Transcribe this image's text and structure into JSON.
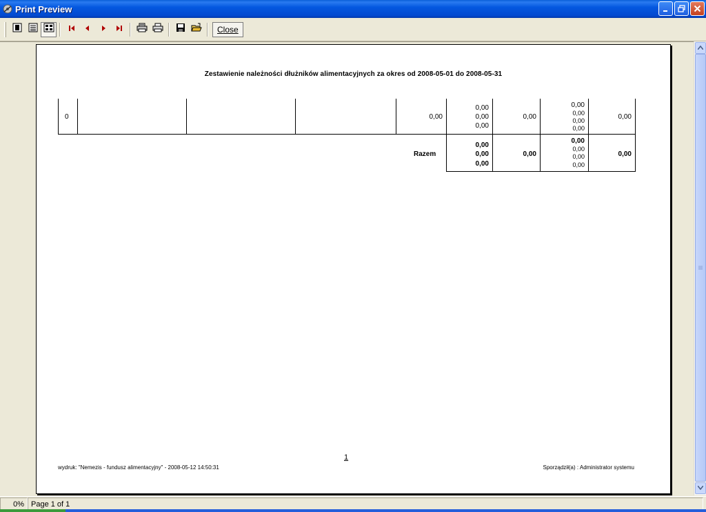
{
  "window": {
    "title": "Print Preview",
    "buttons": [
      "minimize",
      "restore",
      "close"
    ]
  },
  "toolbar": {
    "close_label": "Close",
    "icons": [
      "one-page-icon",
      "continuous-icon",
      "multi-page-icon",
      "first-page-icon",
      "prev-page-icon",
      "next-page-icon",
      "last-page-icon",
      "printer-setup-icon",
      "print-icon",
      "save-icon",
      "open-icon"
    ]
  },
  "report": {
    "title": "Zestawienie należności dłużników alimentacyjnych za okres od 2008-05-01 do 2008-05-31",
    "row": {
      "lp": "0",
      "col5": "0,00",
      "col6": [
        "0,00",
        "0,00",
        "0,00"
      ],
      "col7": "0,00",
      "col8": [
        "0,00",
        "0,00",
        "0,00",
        "0,00"
      ],
      "col9": "0,00"
    },
    "total": {
      "label": "Razem",
      "col6": [
        "0,00",
        "0,00",
        "0,00"
      ],
      "col7": "0,00",
      "col8": [
        "0,00",
        "0,00",
        "0,00",
        "0,00"
      ],
      "col9": "0,00"
    },
    "page_number": "1",
    "footer_left": "wydruk: \"Nemezis - fundusz alimentacyjny\" - 2008-05-12 14:50:31",
    "footer_right": "Sporządził(a) : Administrator systemu"
  },
  "status": {
    "zoom": "0%",
    "page": "Page 1 of 1"
  }
}
